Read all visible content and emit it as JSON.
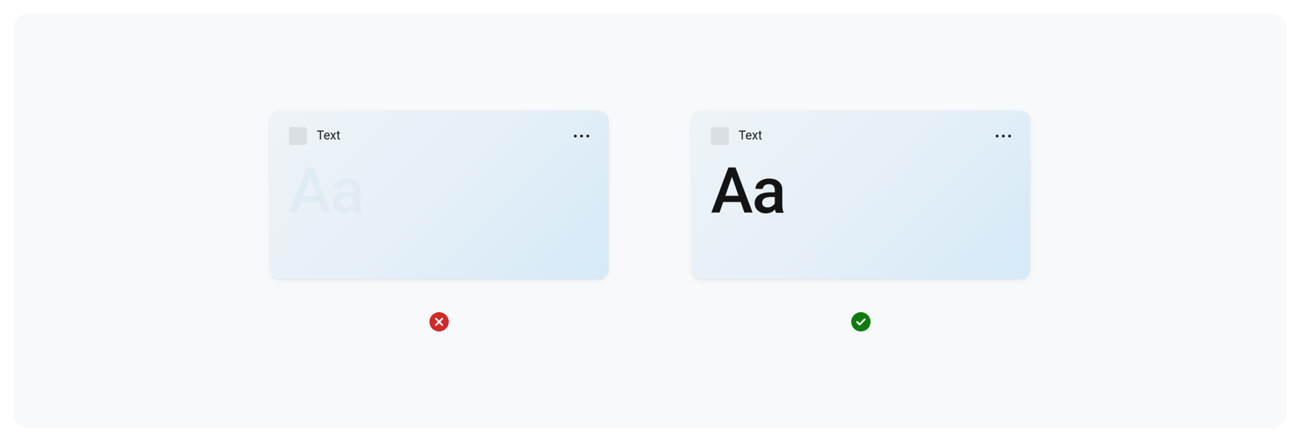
{
  "examples": {
    "bad": {
      "title": "Text",
      "sample": "Aa",
      "status": "error"
    },
    "good": {
      "title": "Text",
      "sample": "Aa",
      "status": "success"
    }
  },
  "colors": {
    "error": "#cf2a27",
    "success": "#0f7b0f"
  }
}
